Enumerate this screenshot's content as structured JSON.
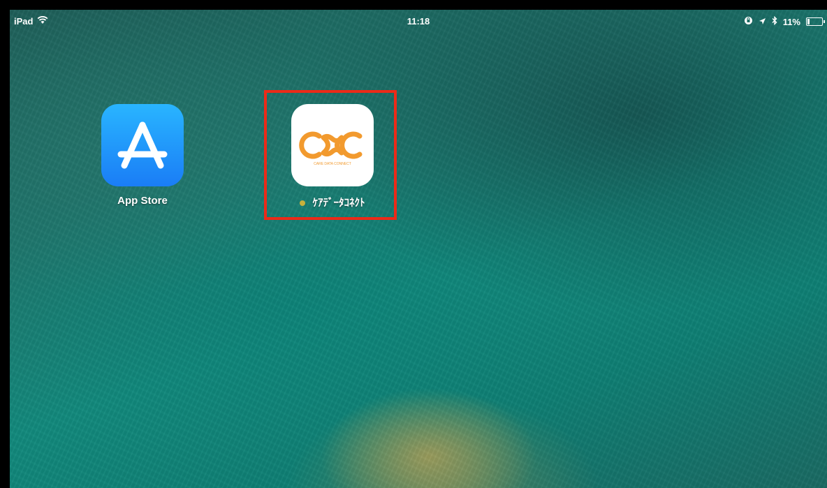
{
  "status_bar": {
    "device": "iPad",
    "time": "11:18",
    "battery": "11%"
  },
  "apps": [
    {
      "label": "App Store",
      "icon": "app-store-icon"
    },
    {
      "label": "ｹｱﾃﾞｰﾀｺﾈｸﾄ",
      "icon": "cdc-logo-icon",
      "logo_subtext": "CARE DATA CONNECT",
      "logo_text": "CDC"
    }
  ],
  "colors": {
    "highlight": "#ec2a18",
    "cdc_orange": "#f29a2e",
    "appstore_blue": "#1a7df6",
    "new_dot": "#c7b13b"
  }
}
